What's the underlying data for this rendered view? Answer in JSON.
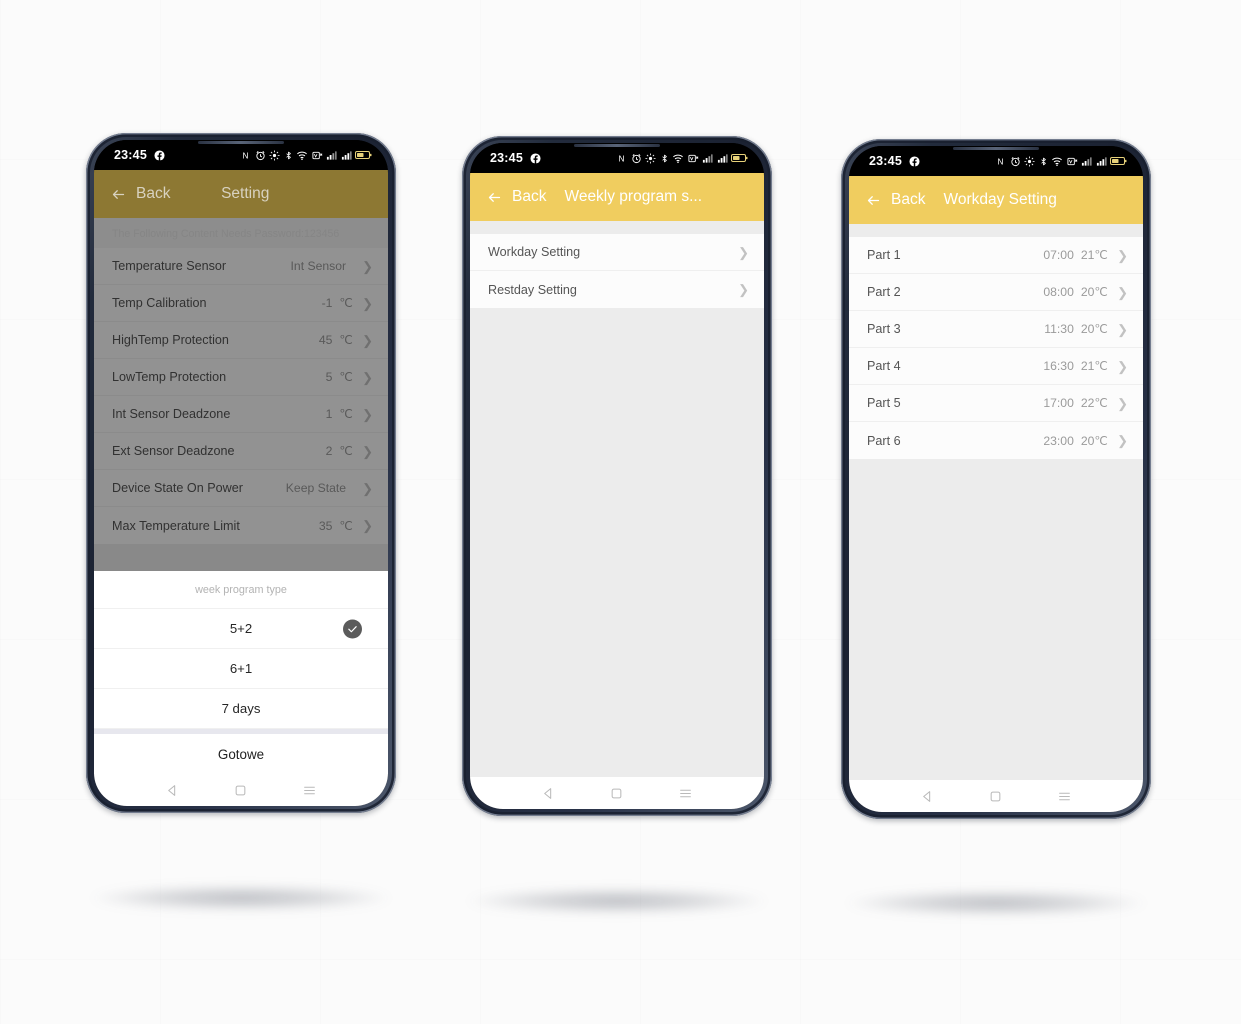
{
  "status_bar": {
    "time": "23:45",
    "icons_left": [
      "facebook-icon"
    ],
    "icons_right": [
      "nfc-icon",
      "alarm-icon",
      "location-icon",
      "bluetooth-icon",
      "wifi-icon",
      "volte-icon",
      "signal-sim1-icon",
      "signal-sim2-icon",
      "battery-icon"
    ]
  },
  "colors": {
    "accent_yellow": "#f0cd5f",
    "accent_yellow_dim": "#8d7833",
    "list_bg": "#fcfcfc",
    "page_bg": "#ececec",
    "frame": "#222b3c",
    "check_badge": "#5b5b5b"
  },
  "nav_bar": {
    "back_label": "back-triangle-icon",
    "home_label": "home-square-icon",
    "recents_label": "recents-menu-icon"
  },
  "phone1": {
    "header": {
      "back": "Back",
      "title": "Setting"
    },
    "password_note": "The Following Content Needs Password:123456",
    "rows": [
      {
        "label": "Temperature Sensor",
        "value": "Int Sensor",
        "unit": ""
      },
      {
        "label": "Temp Calibration",
        "value": "-1",
        "unit": "℃"
      },
      {
        "label": "HighTemp Protection",
        "value": "45",
        "unit": "℃"
      },
      {
        "label": "LowTemp Protection",
        "value": "5",
        "unit": "℃"
      },
      {
        "label": "Int Sensor Deadzone",
        "value": "1",
        "unit": "℃"
      },
      {
        "label": "Ext Sensor Deadzone",
        "value": "2",
        "unit": "℃"
      },
      {
        "label": "Device State On Power",
        "value": "Keep State",
        "unit": ""
      },
      {
        "label": "Max Temperature Limit",
        "value": "35",
        "unit": "℃"
      }
    ],
    "sheet": {
      "title": "week program type",
      "options": [
        {
          "label": "5+2",
          "selected": true
        },
        {
          "label": "6+1",
          "selected": false
        },
        {
          "label": "7 days",
          "selected": false
        }
      ],
      "done_label": "Gotowe"
    }
  },
  "phone2": {
    "header": {
      "back": "Back",
      "title": "Weekly program s..."
    },
    "rows": [
      {
        "label": "Workday Setting"
      },
      {
        "label": "Restday Setting"
      }
    ]
  },
  "phone3": {
    "header": {
      "back": "Back",
      "title": "Workday Setting"
    },
    "rows": [
      {
        "label": "Part 1",
        "time": "07:00",
        "temp": "21℃"
      },
      {
        "label": "Part 2",
        "time": "08:00",
        "temp": "20℃"
      },
      {
        "label": "Part 3",
        "time": "11:30",
        "temp": "20℃"
      },
      {
        "label": "Part 4",
        "time": "16:30",
        "temp": "21℃"
      },
      {
        "label": "Part 5",
        "time": "17:00",
        "temp": "22℃"
      },
      {
        "label": "Part 6",
        "time": "23:00",
        "temp": "20℃"
      }
    ]
  }
}
